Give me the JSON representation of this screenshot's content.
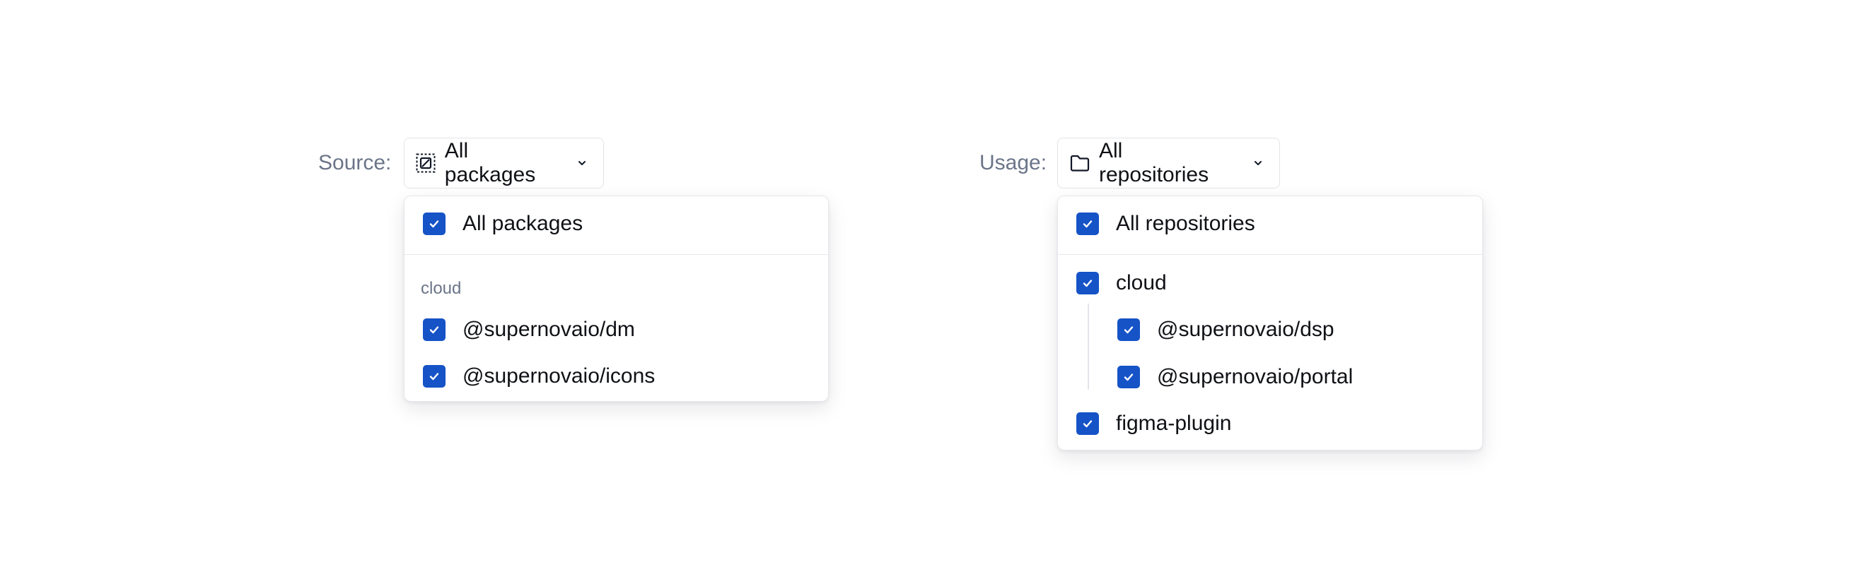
{
  "source": {
    "label": "Source:",
    "trigger_label": "All packages",
    "trigger_icon": "package-icon",
    "menu": {
      "all_option": "All packages",
      "group_label": "cloud",
      "items": [
        "@supernovaio/dm",
        "@supernovaio/icons"
      ]
    }
  },
  "usage": {
    "label": "Usage:",
    "trigger_label": "All repositories",
    "trigger_icon": "folder-icon",
    "menu": {
      "all_option": "All repositories",
      "groups": [
        {
          "label": "cloud",
          "children": [
            "@supernovaio/dsp",
            "@supernovaio/portal"
          ]
        },
        {
          "label": "figma-plugin",
          "children": []
        }
      ]
    }
  },
  "colors": {
    "checkbox": "#1553c7",
    "muted_text": "#6b7589",
    "border": "#e2e4e9"
  }
}
